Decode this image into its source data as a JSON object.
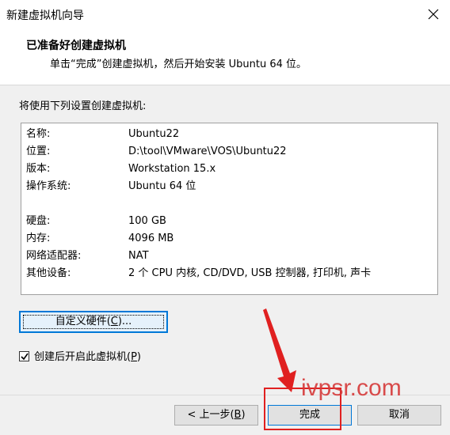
{
  "window": {
    "title": "新建虚拟机向导"
  },
  "header": {
    "title": "已准备好创建虚拟机",
    "subtitle": "单击“完成”创建虚拟机，然后开始安装 Ubuntu 64 位。"
  },
  "intro_text": "将使用下列设置创建虚拟机:",
  "summary": [
    {
      "key": "名称:",
      "value": "Ubuntu22"
    },
    {
      "key": "位置:",
      "value": "D:\\tool\\VMware\\VOS\\Ubuntu22"
    },
    {
      "key": "版本:",
      "value": "Workstation 15.x"
    },
    {
      "key": "操作系统:",
      "value": "Ubuntu 64 位"
    },
    {
      "key": "硬盘:",
      "value": "100 GB"
    },
    {
      "key": "内存:",
      "value": "4096 MB"
    },
    {
      "key": "网络适配器:",
      "value": "NAT"
    },
    {
      "key": "其他设备:",
      "value": "2 个 CPU 内核, CD/DVD, USB 控制器, 打印机, 声卡"
    }
  ],
  "buttons": {
    "customize_pre": "自定义硬件(",
    "customize_key": "C",
    "customize_post": ")...",
    "back_pre": "< 上一步(",
    "back_key": "B",
    "back_post": ")",
    "finish": "完成",
    "cancel": "取消"
  },
  "checkbox": {
    "checked": true,
    "label_pre": "创建后开启此虚拟机(",
    "label_key": "P",
    "label_post": ")"
  },
  "watermark": "ivpsr.com",
  "colors": {
    "accent": "#0078d7",
    "annotation": "#e02020"
  }
}
